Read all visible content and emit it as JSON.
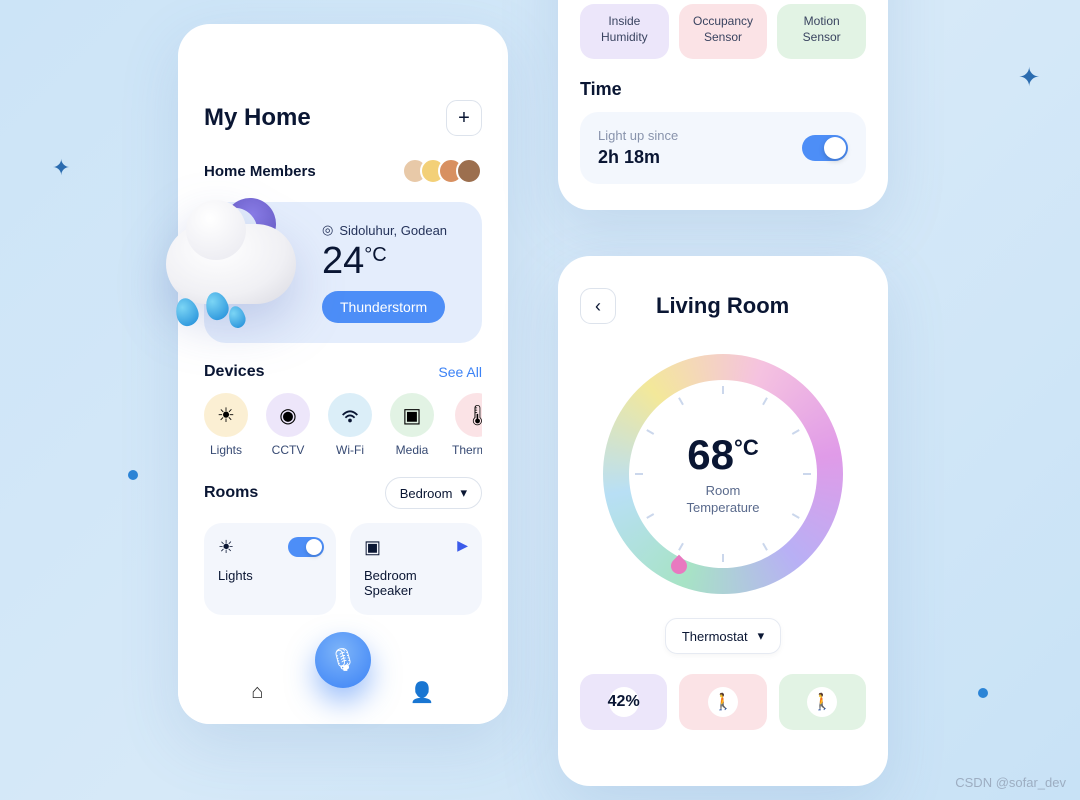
{
  "left": {
    "title": "My Home",
    "members_label": "Home Members",
    "weather": {
      "location": "Sidoluhur, Godean",
      "temperature": "24",
      "unit": "°C",
      "condition": "Thunderstorm"
    },
    "devices_title": "Devices",
    "see_all": "See All",
    "devices": [
      {
        "label": "Lights",
        "icon": "☀"
      },
      {
        "label": "CCTV",
        "icon": "◉"
      },
      {
        "label": "Wi-Fi",
        "icon": "⌇"
      },
      {
        "label": "Media",
        "icon": "▣"
      },
      {
        "label": "Thermost",
        "icon": "🌡"
      }
    ],
    "rooms_title": "Rooms",
    "room_filter": "Bedroom",
    "room_cards": [
      {
        "name": "Lights",
        "icon": "☀",
        "toggle": true
      },
      {
        "name": "Bedroom Speaker",
        "icon": "▣",
        "play": true
      }
    ]
  },
  "rightTop": {
    "sensors": [
      {
        "l1": "Inside",
        "l2": "Humidity"
      },
      {
        "l1": "Occupancy",
        "l2": "Sensor"
      },
      {
        "l1": "Motion",
        "l2": "Sensor"
      }
    ],
    "time_title": "Time",
    "lightup_label": "Light up since",
    "lightup_value": "2h 18m"
  },
  "rightBottom": {
    "title": "Living Room",
    "dial_temp": "68",
    "dial_unit": "°C",
    "dial_sub": "Room\nTemperature",
    "thermo_select": "Thermostat",
    "stats": [
      {
        "value": "42%"
      },
      {
        "icon": "🚶"
      },
      {
        "icon": "🚶"
      }
    ]
  },
  "watermark": "CSDN @sofar_dev"
}
